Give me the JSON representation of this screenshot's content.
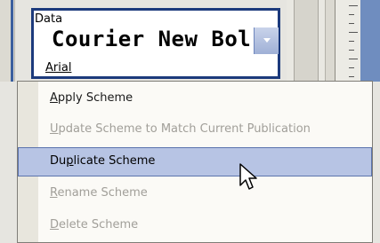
{
  "font_combo": {
    "label": "Data",
    "value": "Courier New Bol",
    "sub_value": "Arial",
    "dropdown_icon": "chevron-down-icon"
  },
  "context_menu": {
    "items": [
      {
        "pre": "",
        "key": "A",
        "post": "pply Scheme",
        "enabled": true,
        "selected": false
      },
      {
        "pre": "",
        "key": "U",
        "post": "pdate Scheme to Match Current Publication",
        "enabled": false,
        "selected": false
      },
      {
        "pre": "Du",
        "key": "p",
        "post": "licate Scheme",
        "enabled": true,
        "selected": true
      },
      {
        "pre": "",
        "key": "R",
        "post": "ename Scheme",
        "enabled": false,
        "selected": false
      },
      {
        "pre": "",
        "key": "D",
        "post": "elete Scheme",
        "enabled": false,
        "selected": false
      }
    ]
  },
  "colors": {
    "selection_bg": "#b7c4e4",
    "selection_border": "#5b73ad",
    "combo_border": "#1c3a7c",
    "disabled_text": "#a19f99"
  },
  "cursor": "arrow-pointer-icon"
}
